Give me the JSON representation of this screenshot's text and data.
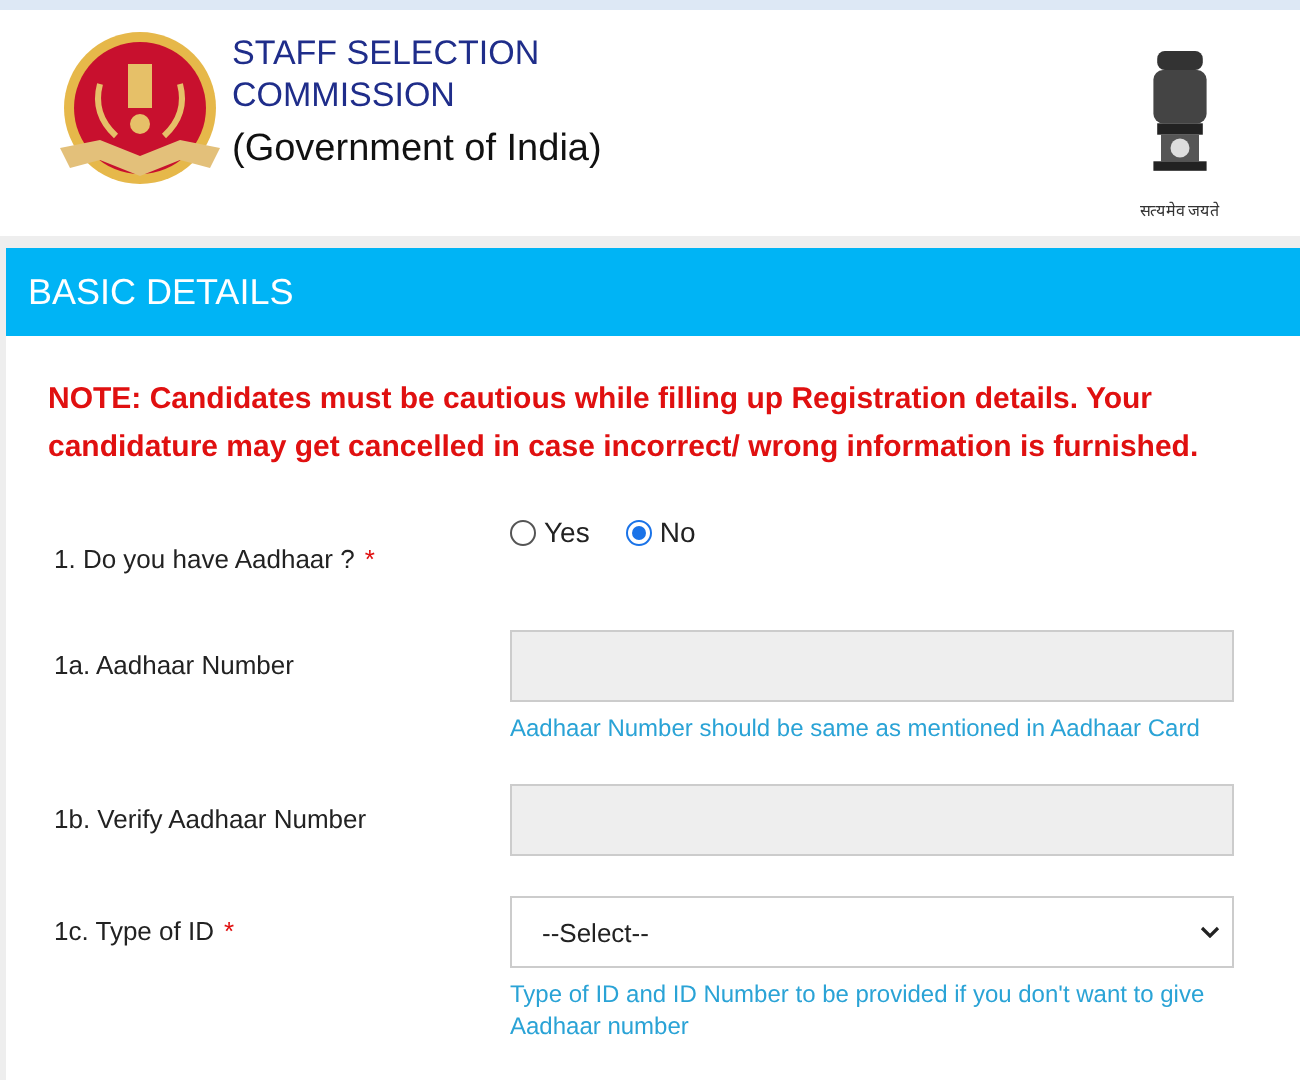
{
  "header": {
    "title_lines": [
      "STAFF SELECTION",
      "COMMISSION"
    ],
    "subtitle": "(Government of India)",
    "emblem_motto": "सत्यमेव जयते"
  },
  "section": {
    "title": "BASIC DETAILS",
    "note": "**NOTE:** Candidates must be cautious while filling up Registration details. Your candidature may get cancelled in case incorrect/ wrong information is furnished.",
    "fields": [
      {
        "kind": "radio",
        "label": "1. Do you have Aadhaar ?",
        "required_mark": "*",
        "options": [
          {
            "label": "Yes",
            "selected": false
          },
          {
            "label": "No",
            "selected": true
          }
        ]
      },
      {
        "kind": "text",
        "label": "1a. Aadhaar Number",
        "disabled": true,
        "hint": "Aadhaar Number should be same as mentioned in Aadhaar Card"
      },
      {
        "kind": "text",
        "label": "1b. Verify Aadhaar Number",
        "disabled": true
      },
      {
        "kind": "select",
        "label": "1c. Type of ID",
        "required_mark": "*",
        "value": "--Select--",
        "hint": "Type of ID and ID Number to be provided if you don't want to give Aadhaar number"
      }
    ]
  }
}
